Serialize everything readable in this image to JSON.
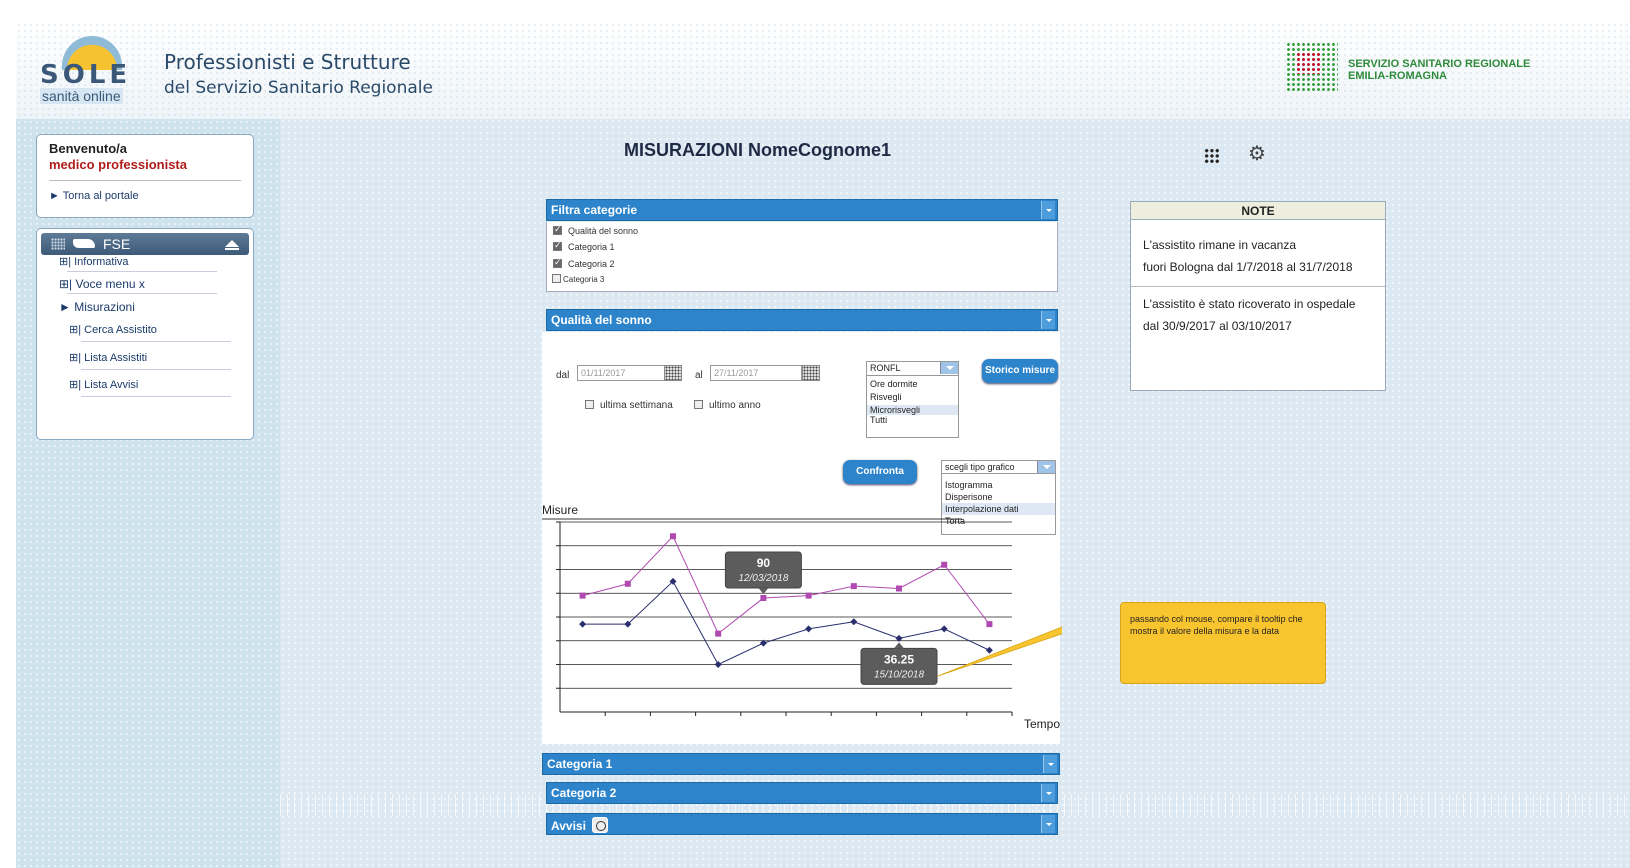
{
  "header": {
    "logo_word": "SOLE",
    "logo_sub": "sanità online",
    "title_line1": "Professionisti e Strutture",
    "title_line2": "del Servizio Sanitario Regionale",
    "ssr_line1": "SERVIZIO SANITARIO REGIONALE",
    "ssr_line2": "EMILIA-ROMAGNA"
  },
  "welcome": {
    "greeting": "Benvenuto/a",
    "role": "medico professionista",
    "portal_link": "► Torna al portale"
  },
  "menu": {
    "header": "FSE",
    "items": [
      {
        "label": "⊞| Informativa"
      },
      {
        "label": "⊞| Voce menu x"
      },
      {
        "label": "► Misurazioni"
      },
      {
        "label": "⊞| Cerca Assistito"
      },
      {
        "label": "⊞| Lista Assistiti"
      },
      {
        "label": "⊞| Lista Avvisi"
      }
    ]
  },
  "main": {
    "title": "MISURAZIONI NomeCognome1"
  },
  "filter": {
    "title": "Filtra categorie",
    "categories": [
      {
        "label": "Qualità del sonno",
        "checked": true
      },
      {
        "label": "Categoria 1",
        "checked": true
      },
      {
        "label": "Categoria 2",
        "checked": true
      },
      {
        "label": "Categoria 3",
        "checked": false
      }
    ]
  },
  "sleep": {
    "title": "Qualità del sonno",
    "from_label": "dal",
    "from_value": "01/11/2017",
    "to_label": "al",
    "to_value": "27/11/2017",
    "last_week": "ultima settimana",
    "last_year": "ultimo anno",
    "measure_select": {
      "selected": "RONFL",
      "options": [
        "Ore dormite",
        "Risvegli",
        "Microrisvegli",
        "Tutti"
      ],
      "highlighted": "Microrisvegli"
    },
    "history_button": "Storico misure",
    "compare_button": "Confronta",
    "chart_type_select": {
      "selected": "scegli tipo grafico",
      "options": [
        "Istogramma",
        "Disperisone",
        "Interpolazione dati",
        "Torta"
      ],
      "highlighted": "Interpolazione dati"
    }
  },
  "chart_data": {
    "type": "line",
    "ylabel": "Misure",
    "xlabel": "Tempo",
    "ylim": [
      0,
      8
    ],
    "grid": true,
    "x_count": 11,
    "series": [
      {
        "color": "#b04ab0",
        "marker": "square",
        "values": [
          4.9,
          5.4,
          7.4,
          3.3,
          4.8,
          4.9,
          5.3,
          5.2,
          6.2,
          3.7
        ]
      },
      {
        "color": "#2a2f6e",
        "marker": "diamond",
        "values": [
          3.7,
          3.7,
          5.5,
          2.0,
          2.9,
          3.5,
          3.8,
          3.1,
          3.5,
          2.6
        ]
      }
    ],
    "tooltips": [
      {
        "value": "90",
        "date": "12/03/2018"
      },
      {
        "value": "36.25",
        "date": "15/10/2018"
      }
    ]
  },
  "callout": {
    "text": "passando col mouse, compare il tooltip che mostra il valore della misura e la data"
  },
  "notes": {
    "title": "NOTE",
    "note1_line1": "L'assistito rimane in vacanza",
    "note1_line2": "fuori Bologna dal 1/7/2018 al 31/7/2018",
    "note2_line1": "L'assistito è stato ricoverato in ospedale",
    "note2_line2": "dal 30/9/2017 al 03/10/2017"
  },
  "sections": {
    "cat1": "Categoria 1",
    "cat2": "Categoria 2",
    "avvisi": "Avvisi"
  },
  "colors": {
    "accent_blue": "#2e84cb",
    "callout_yellow": "#f9c52f",
    "role_red": "#b01c1c"
  }
}
